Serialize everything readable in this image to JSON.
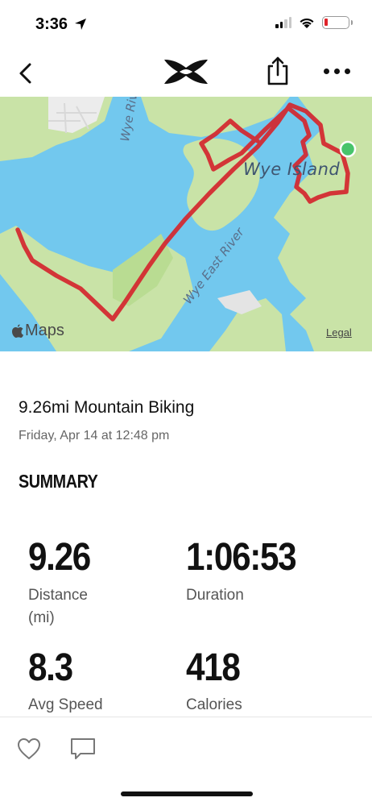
{
  "status_bar": {
    "time": "3:36",
    "battery_color": "#e0242b"
  },
  "nav": {
    "back_icon": "chevron-left-icon",
    "logo": "under-armour-logo",
    "share_icon": "share-icon",
    "more_icon": "more-horizontal-icon"
  },
  "map": {
    "labels": {
      "wye_river": "Wye River",
      "wye_island": "Wye Island",
      "wye_east_river": "Wye East River"
    },
    "credit": "Maps",
    "legal": "Legal",
    "route_color": "#d4262e",
    "end_marker_color": "#47c46b",
    "water_color": "#72c8ee",
    "land_color": "#c9e3a7"
  },
  "activity": {
    "title": "9.26mi Mountain Biking",
    "date": "Friday, Apr 14 at 12:48 pm"
  },
  "summary": {
    "heading": "SUMMARY",
    "stats": [
      {
        "value": "9.26",
        "label": "Distance (mi)"
      },
      {
        "value": "1:06:53",
        "label": "Duration"
      },
      {
        "value": "8.3",
        "label": "Avg Speed"
      },
      {
        "value": "418",
        "label": "Calories"
      }
    ]
  },
  "bottom_bar": {
    "like_icon": "heart-icon",
    "comment_icon": "comment-icon"
  }
}
